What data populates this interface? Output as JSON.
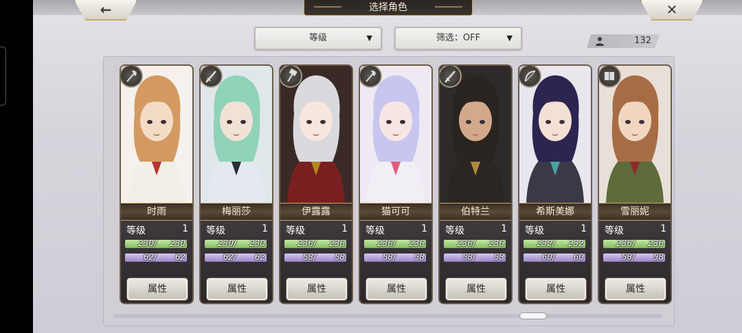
{
  "header": {
    "title": "选择角色",
    "back_icon": "←",
    "close_icon": "✕"
  },
  "controls": {
    "sort_label": "等级",
    "filter_label": "筛选：OFF",
    "dropdown_arrow": "▼",
    "owned_count": "132"
  },
  "level_label": "等级",
  "attr_button": "属性",
  "characters": [
    {
      "name": "时雨",
      "level": "1",
      "hp": "230",
      "hp_max": "230",
      "mp": "62",
      "mp_max": "62",
      "weapon": "axe-icon",
      "hair": "#d39a62",
      "skin": "#f3dcc6",
      "outfit": "#f2efe9",
      "accent": "#b8342e",
      "bg": "#f6f1ec"
    },
    {
      "name": "梅丽莎",
      "level": "1",
      "hp": "230",
      "hp_max": "230",
      "mp": "62",
      "mp_max": "62",
      "weapon": "sword-icon",
      "hair": "#8fd3b8",
      "skin": "#f1e2d6",
      "outfit": "#e4e8ef",
      "accent": "#2a2d33",
      "bg": "#dfe7ea"
    },
    {
      "name": "伊露露",
      "level": "1",
      "hp": "236",
      "hp_max": "236",
      "mp": "58",
      "mp_max": "58",
      "weapon": "hammer-icon",
      "hair": "#d9d9de",
      "skin": "#f6e6df",
      "outfit": "#7a1f1f",
      "accent": "#b3871f",
      "bg": "#3a2a26"
    },
    {
      "name": "猫可可",
      "level": "1",
      "hp": "236",
      "hp_max": "236",
      "mp": "58",
      "mp_max": "58",
      "weapon": "axe-icon",
      "hair": "#c8c6ef",
      "skin": "#f7e7e4",
      "outfit": "#f1eef5",
      "accent": "#e25e7a",
      "bg": "#efe9f3"
    },
    {
      "name": "伯特兰",
      "level": "1",
      "hp": "236",
      "hp_max": "236",
      "mp": "58",
      "mp_max": "58",
      "weapon": "sword-icon",
      "hair": "#2a2420",
      "skin": "#d3a98b",
      "outfit": "#2b2622",
      "accent": "#b08a3e",
      "bg": "#2f2a2a"
    },
    {
      "name": "希斯美娜",
      "level": "1",
      "hp": "232",
      "hp_max": "232",
      "mp": "60",
      "mp_max": "60",
      "weapon": "bow-icon",
      "hair": "#2b2550",
      "skin": "#f5e0d5",
      "outfit": "#3a3a46",
      "accent": "#4aa3a0",
      "bg": "#e9e6ee"
    },
    {
      "name": "雪丽妮",
      "level": "1",
      "hp": "236",
      "hp_max": "236",
      "mp": "58",
      "mp_max": "58",
      "weapon": "book-icon",
      "hair": "#a66d45",
      "skin": "#f1d6c0",
      "outfit": "#5e6b3a",
      "accent": "#8d2b2b",
      "bg": "#e8e0d8"
    }
  ]
}
